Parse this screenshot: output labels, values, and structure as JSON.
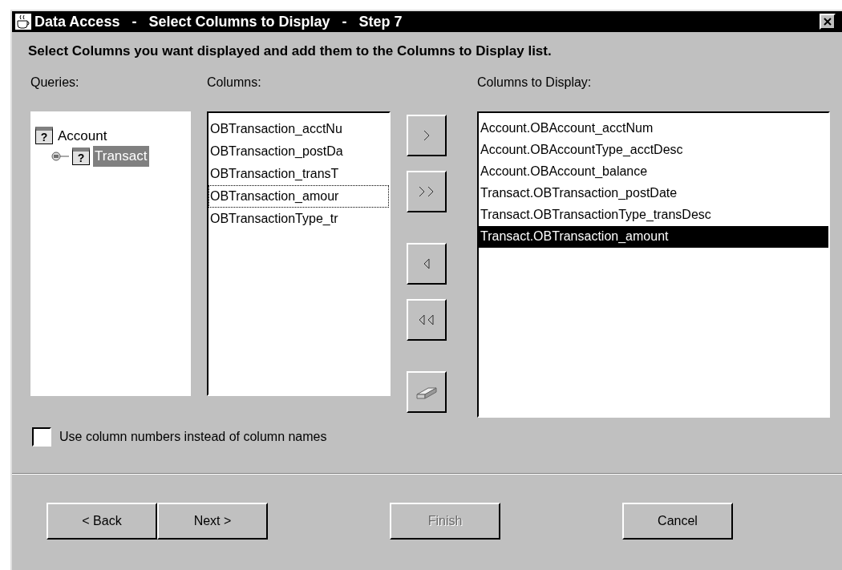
{
  "window": {
    "title": "Data Access   -   Select Columns to Display   -   Step 7"
  },
  "instruction": "Select Columns you want displayed and add them to the Columns to Display list.",
  "queries": {
    "label": "Queries:",
    "tree": [
      {
        "label": "Account",
        "icon": "?",
        "selected": false,
        "children": [
          {
            "label": "Transact",
            "icon": "?",
            "selected": true
          }
        ]
      }
    ]
  },
  "columns": {
    "label": "Columns:",
    "items": [
      {
        "label": "OBTransaction_acctNu",
        "focused": false
      },
      {
        "label": "OBTransaction_postDa",
        "focused": false
      },
      {
        "label": "OBTransaction_transT",
        "focused": false
      },
      {
        "label": "OBTransaction_amour",
        "focused": true
      },
      {
        "label": "OBTransactionType_tr",
        "focused": false
      }
    ]
  },
  "columns_to_display": {
    "label": "Columns to Display:",
    "items": [
      {
        "label": "Account.OBAccount_acctNum",
        "selected": false
      },
      {
        "label": "Account.OBAccountType_acctDesc",
        "selected": false
      },
      {
        "label": "Account.OBAccount_balance",
        "selected": false
      },
      {
        "label": "Transact.OBTransaction_postDate",
        "selected": false
      },
      {
        "label": "Transact.OBTransactionType_transDesc",
        "selected": false
      },
      {
        "label": "Transact.OBTransaction_amount",
        "selected": true
      }
    ]
  },
  "option": {
    "label": "Use column numbers instead of column names",
    "checked": false
  },
  "buttons": [
    {
      "label": "< Back",
      "disabled": false
    },
    {
      "label": "Next >",
      "disabled": false
    },
    {
      "label": "Finish",
      "disabled": true
    },
    {
      "label": "Cancel",
      "disabled": false
    }
  ]
}
